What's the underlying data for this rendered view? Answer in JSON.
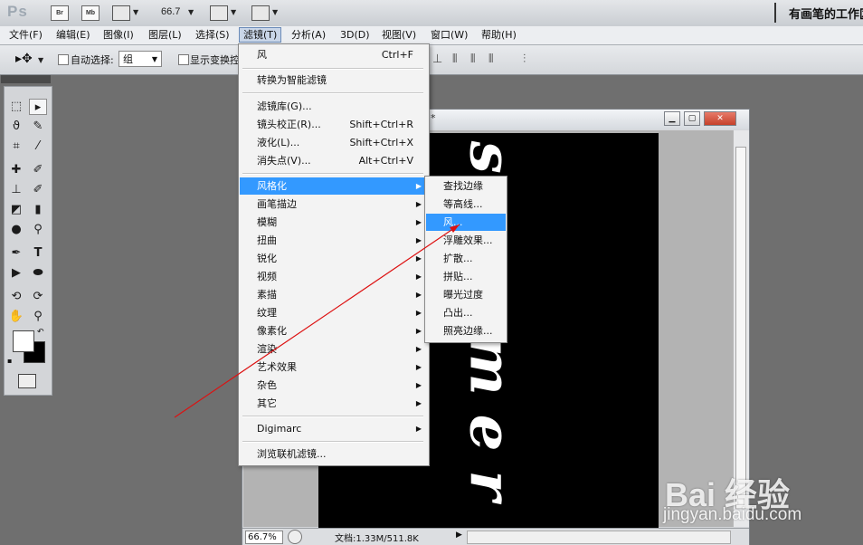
{
  "app": {
    "logo": "Ps",
    "bridge_label": "Br",
    "minibridge_label": "Mb",
    "zoom_readout": "66.7",
    "workspace_name": "有画笔的工作区"
  },
  "menubar": {
    "items": [
      "文件(F)",
      "编辑(E)",
      "图像(I)",
      "图层(L)",
      "选择(S)",
      "滤镜(T)",
      "分析(A)",
      "3D(D)",
      "视图(V)",
      "窗口(W)",
      "帮助(H)"
    ],
    "active": "滤镜(T)"
  },
  "options": {
    "auto_select_label": "自动选择:",
    "auto_select_value": "组",
    "show_transform_label": "显示变换控"
  },
  "filter_menu": {
    "last_filter": {
      "label": "风",
      "shortcut": "Ctrl+F"
    },
    "convert_smart": "转换为智能滤镜",
    "group2": [
      {
        "label": "滤镜库(G)...",
        "shortcut": ""
      },
      {
        "label": "镜头校正(R)...",
        "shortcut": "Shift+Ctrl+R"
      },
      {
        "label": "液化(L)...",
        "shortcut": "Shift+Ctrl+X"
      },
      {
        "label": "消失点(V)...",
        "shortcut": "Alt+Ctrl+V"
      }
    ],
    "submenus": [
      "风格化",
      "画笔描边",
      "模糊",
      "扭曲",
      "锐化",
      "视频",
      "素描",
      "纹理",
      "像素化",
      "渲染",
      "艺术效果",
      "杂色",
      "其它"
    ],
    "highlighted": "风格化",
    "digimarc": "Digimarc",
    "browse_online": "浏览联机滤镜..."
  },
  "stylize_menu": {
    "items": [
      "查找边缘",
      "等高线...",
      "风...",
      "浮雕效果...",
      "扩散...",
      "拼贴...",
      "曝光过度",
      "凸出...",
      "照亮边缘..."
    ],
    "highlighted": "风..."
  },
  "document": {
    "artwork_text": "summer",
    "zoom": "66.7%",
    "doc_info": "文档:1.33M/511.8K"
  },
  "watermark": {
    "logo": "Bai 经验",
    "url": "jingyan.baidu.com"
  },
  "colors": {
    "menu_highlight": "#3399ff",
    "annotation_arrow": "#dd1111"
  }
}
